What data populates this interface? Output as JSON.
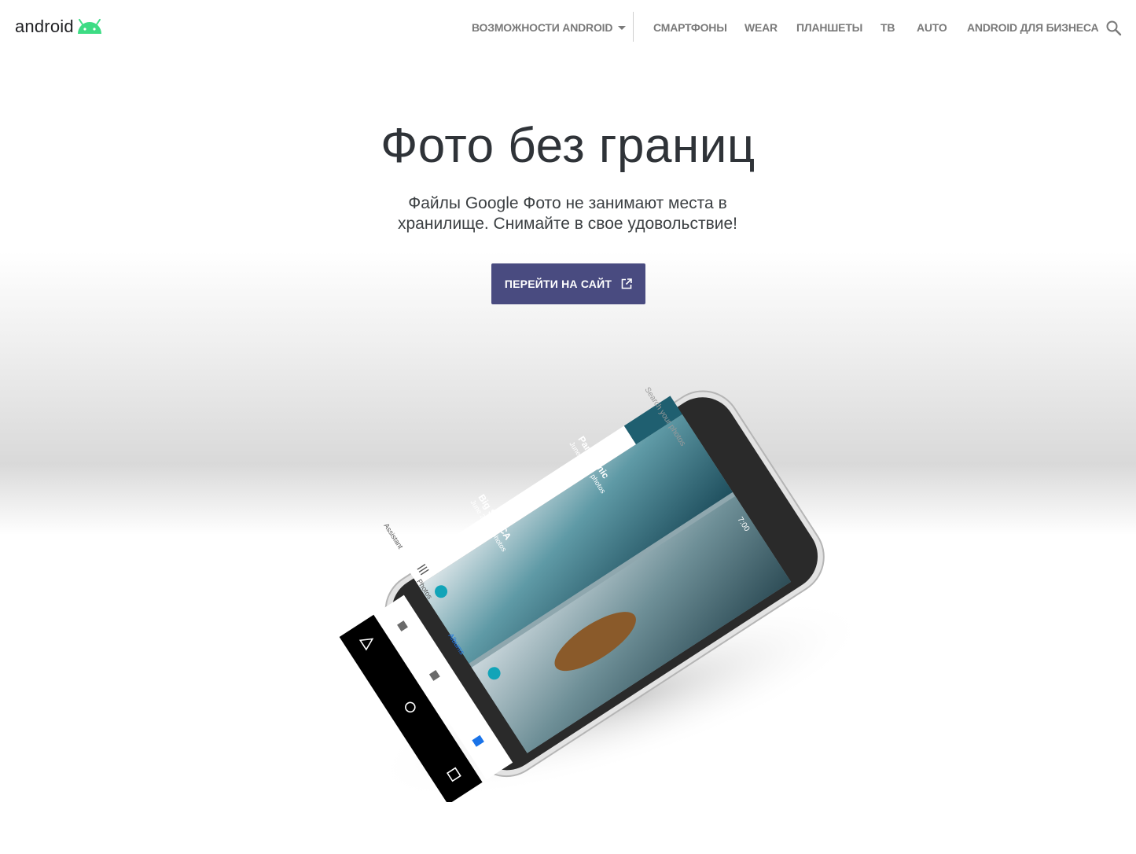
{
  "header": {
    "logo_text": "android",
    "nav": [
      {
        "label": "ВОЗМОЖНОСТИ ANDROID",
        "has_dropdown": true
      },
      {
        "label": "СМАРТФОНЫ"
      },
      {
        "label": "WEAR"
      },
      {
        "label": "ПЛАНШЕТЫ"
      },
      {
        "label": "ТВ"
      },
      {
        "label": "AUTO"
      },
      {
        "label": "ANDROID ДЛЯ БИЗНЕСА"
      }
    ],
    "search_icon": "search-icon"
  },
  "hero": {
    "title": "Фото без границ",
    "subtitle": "Файлы Google Фото не занимают места в хранилище. Снимайте в свое удовольствие!",
    "cta_label": "ПЕРЕЙТИ НА САЙТ",
    "cta_icon": "external-link-icon"
  },
  "phone_screen": {
    "search_placeholder": "Search your photos",
    "time": "7:00",
    "albums": [
      {
        "title": "Panoramic",
        "meta": "June 10, 20 photos"
      },
      {
        "title": "Big Sur, CA",
        "meta": "June 25, 25 photos"
      }
    ],
    "bottom_nav": [
      "Assistant",
      "Photos",
      "Albums"
    ]
  },
  "colors": {
    "cta_background": "#494b80",
    "android_green": "#3ddc84",
    "nav_text": "#7a7a7a",
    "active_tab": "#1a73e8"
  }
}
